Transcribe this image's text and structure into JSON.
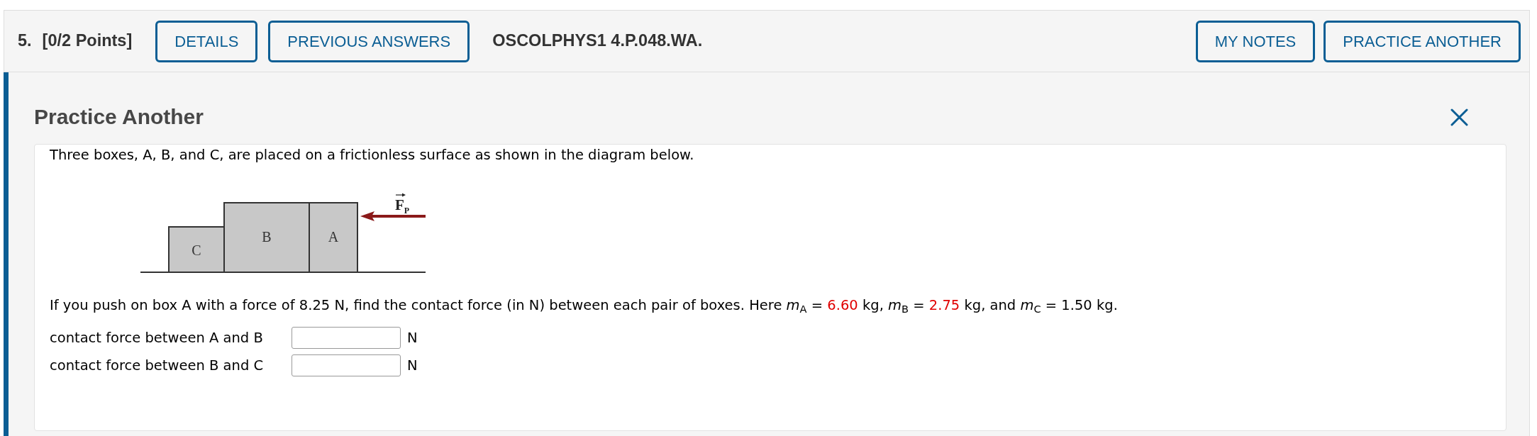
{
  "question_header": {
    "number": "5.",
    "points": "[0/2 Points]",
    "left_buttons": [
      {
        "label": "DETAILS"
      },
      {
        "label": "PREVIOUS ANSWERS"
      }
    ],
    "code": "OSCOLPHYS1 4.P.048.WA.",
    "right_buttons": [
      {
        "label": "MY NOTES"
      },
      {
        "label": "PRACTICE ANOTHER"
      }
    ]
  },
  "panel": {
    "title": "Practice Another",
    "intro": "Three boxes, A, B, and C, are placed on a frictionless surface as shown in the diagram below.",
    "diagram": {
      "blocks": [
        {
          "label": "C"
        },
        {
          "label": "B"
        },
        {
          "label": "A"
        }
      ],
      "force_label": {
        "symbol": "F",
        "subscript": "P"
      }
    },
    "question": {
      "segments": [
        {
          "text": "If you push on box A with a force of 8.25 N, find the contact force (in N) between each pair of boxes. Here *m*$_{A}$ = ",
          "highlighted": false
        },
        {
          "text": "6.60",
          "highlighted": true
        },
        {
          "text": " kg, *m*$_{B}$ = ",
          "highlighted": false
        },
        {
          "text": "2.75",
          "highlighted": true
        },
        {
          "text": " kg, and *m*$_{C}$ = 1.50 kg.",
          "highlighted": false
        }
      ]
    },
    "answers": [
      {
        "label": "contact force between A and B",
        "unit": "N"
      },
      {
        "label": "contact force between B and C",
        "unit": "N"
      }
    ]
  }
}
